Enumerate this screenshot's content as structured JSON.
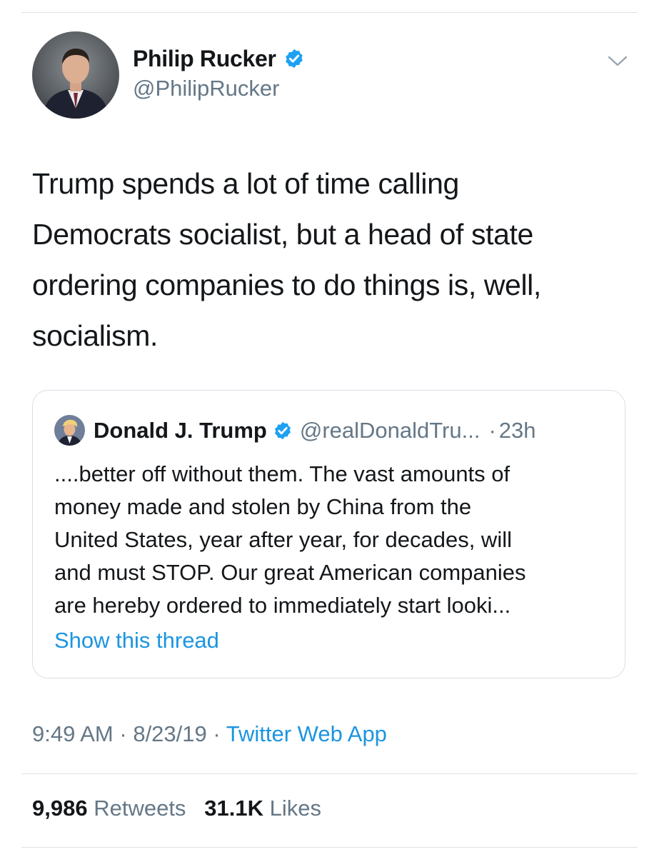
{
  "tweet": {
    "author": {
      "display_name": "Philip Rucker",
      "handle": "@PhilipRucker",
      "verified": true
    },
    "text_lines": [
      "Trump spends a lot of time calling",
      "Democrats socialist, but a head of state",
      "ordering companies to do things is, well,",
      "socialism."
    ],
    "menu_icon": "chevron-down-icon",
    "quoted": {
      "display_name": "Donald J. Trump",
      "handle": "@realDonaldTru...",
      "separator": "·",
      "time": "23h",
      "text_lines": [
        "....better off without them. The vast amounts of",
        "money made and stolen by China from the",
        "United States, year after year, for decades, will",
        "and must STOP. Our great American companies",
        "are hereby ordered to immediately start looki..."
      ],
      "show_thread_label": "Show this thread"
    },
    "meta": {
      "time": "9:49 AM",
      "date": "8/23/19",
      "separator": "·",
      "source": "Twitter Web App"
    },
    "stats": {
      "retweets_count": "9,986",
      "retweets_label": "Retweets",
      "likes_count": "31.1K",
      "likes_label": "Likes"
    }
  },
  "colors": {
    "accent": "#1b95e0",
    "verified": "#1da1f2",
    "secondary_text": "#657786",
    "primary_text": "#14171a",
    "divider": "#dfe3e6"
  }
}
